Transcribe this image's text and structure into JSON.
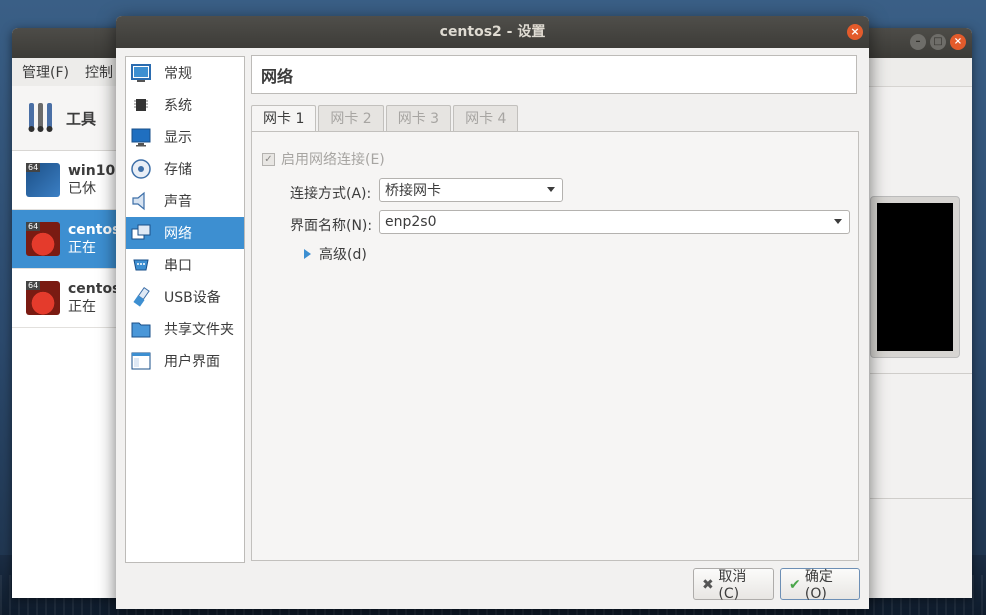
{
  "main_window": {
    "menu": [
      "管理(F)",
      "控制"
    ],
    "tools_label": "工具",
    "vms": [
      {
        "name": "win10",
        "state": "已休"
      },
      {
        "name": "centos",
        "state": "正在"
      },
      {
        "name": "centos",
        "state": "正在"
      }
    ]
  },
  "dialog": {
    "title": "centos2 - 设置",
    "close_glyph": "×",
    "sidebar": [
      {
        "label": "常规",
        "icon": "general-icon"
      },
      {
        "label": "系统",
        "icon": "chip-icon"
      },
      {
        "label": "显示",
        "icon": "monitor-icon"
      },
      {
        "label": "存储",
        "icon": "disk-icon"
      },
      {
        "label": "声音",
        "icon": "speaker-icon"
      },
      {
        "label": "网络",
        "icon": "network-icon"
      },
      {
        "label": "串口",
        "icon": "serial-icon"
      },
      {
        "label": "USB设备",
        "icon": "usb-icon"
      },
      {
        "label": "共享文件夹",
        "icon": "folder-icon"
      },
      {
        "label": "用户界面",
        "icon": "ui-icon"
      }
    ],
    "active_section": "网络",
    "page_title": "网络",
    "tabs": [
      "网卡 1",
      "网卡 2",
      "网卡 3",
      "网卡 4"
    ],
    "enable_label": "启用网络连接(E)",
    "enable_checked": true,
    "attach_label": "连接方式(A):",
    "attach_value": "桥接网卡",
    "interface_label": "界面名称(N):",
    "interface_value": "enp2s0",
    "advanced_label": "高级(d)",
    "cancel_label": "取消(C)",
    "ok_label": "确定(O)"
  },
  "colors": {
    "accent": "#3d8fd1",
    "close": "#e35b2b",
    "titlebar": "#3d3c38"
  }
}
